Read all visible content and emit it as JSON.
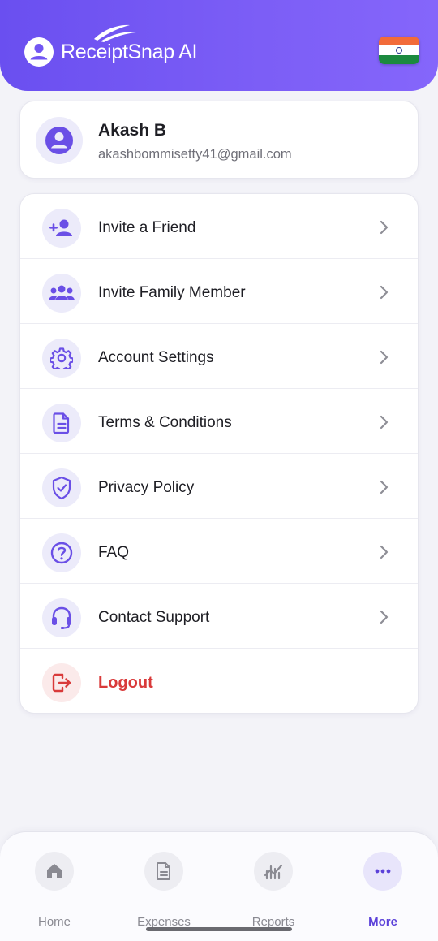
{
  "header": {
    "app_title": "ReceiptSnap AI",
    "accent": "#7256f3",
    "flag": "india-flag"
  },
  "profile": {
    "name": "Akash B",
    "email": "akashbommisetty41@gmail.com",
    "avatar_icon": "user-circle-icon"
  },
  "menu": {
    "items": [
      {
        "label": "Invite a Friend",
        "icon": "add-person-icon"
      },
      {
        "label": "Invite Family Member",
        "icon": "group-icon"
      },
      {
        "label": "Account Settings",
        "icon": "gear-icon"
      },
      {
        "label": "Terms & Conditions",
        "icon": "document-icon"
      },
      {
        "label": "Privacy Policy",
        "icon": "shield-check-icon"
      },
      {
        "label": "FAQ",
        "icon": "question-icon"
      },
      {
        "label": "Contact Support",
        "icon": "headset-icon"
      },
      {
        "label": "Logout",
        "icon": "logout-icon",
        "color": "#d93a3a"
      }
    ]
  },
  "bottom_nav": {
    "items": [
      {
        "label": "Home",
        "icon": "home-icon",
        "active": false
      },
      {
        "label": "Expenses",
        "icon": "receipt-icon",
        "active": false
      },
      {
        "label": "Reports",
        "icon": "chart-icon",
        "active": false
      },
      {
        "label": "More",
        "icon": "more-dots-icon",
        "active": true
      }
    ]
  }
}
